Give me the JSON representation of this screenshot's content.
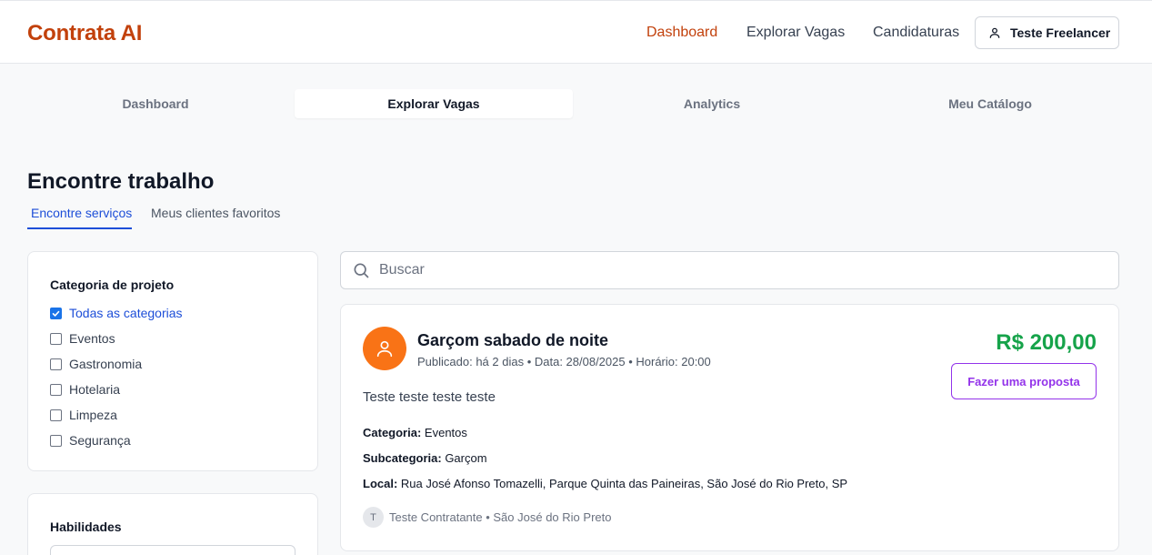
{
  "header": {
    "brand": "Contrata AI",
    "nav": [
      "Dashboard",
      "Explorar Vagas",
      "Candidaturas"
    ],
    "active_nav": "Dashboard",
    "user_name": "Teste Freelancer",
    "user_icon": "person-icon"
  },
  "tabs": {
    "items": [
      "Dashboard",
      "Explorar Vagas",
      "Analytics",
      "Meu Catálogo"
    ],
    "active": "Explorar Vagas"
  },
  "page": {
    "title": "Encontre trabalho",
    "subtabs": [
      "Encontre serviços",
      "Meus clientes favoritos"
    ],
    "active_subtab": "Encontre serviços"
  },
  "filters": {
    "category_title": "Categoria de projeto",
    "categories": [
      {
        "label": "Todas as categorias",
        "checked": true
      },
      {
        "label": "Eventos",
        "checked": false
      },
      {
        "label": "Gastronomia",
        "checked": false
      },
      {
        "label": "Hotelaria",
        "checked": false
      },
      {
        "label": "Limpeza",
        "checked": false
      },
      {
        "label": "Segurança",
        "checked": false
      }
    ],
    "skills_title": "Habilidades"
  },
  "search": {
    "placeholder": "Buscar",
    "value": "",
    "icon": "search-icon"
  },
  "job": {
    "title": "Garçom sabado de noite",
    "meta": "Publicado: há 2 dias • Data: 28/08/2025 • Horário: 20:00",
    "price": "R$ 200,00",
    "cta": "Fazer uma proposta",
    "description": "Teste teste teste teste",
    "category_label": "Categoria:",
    "category_value": "Eventos",
    "subcategory_label": "Subcategoria:",
    "subcategory_value": "Garçom",
    "location_label": "Local:",
    "location_value": "Rua José Afonso Tomazelli, Parque Quinta das Paineiras, São José do Rio Preto, SP",
    "client_initial": "T",
    "client": "Teste Contratante • São José do Rio Preto",
    "avatar_icon": "person-icon"
  },
  "colors": {
    "brand": "#c2410c",
    "link_active": "#1d4ed8",
    "price": "#16a34a",
    "cta": "#9333ea",
    "avatar": "#f97316"
  }
}
